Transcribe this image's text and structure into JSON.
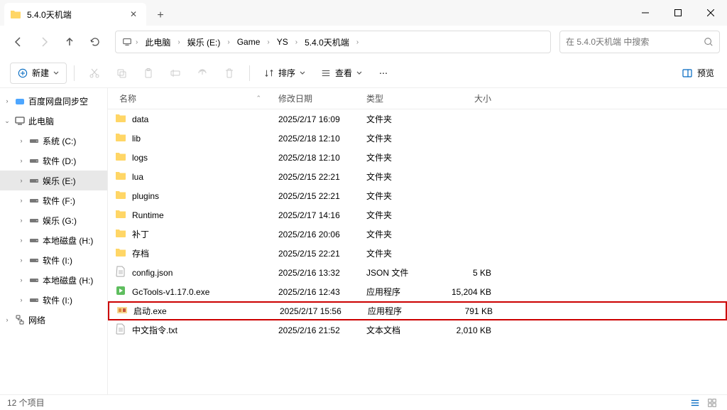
{
  "window": {
    "tab_title": "5.4.0天机端"
  },
  "breadcrumb": {
    "items": [
      "此电脑",
      "娱乐 (E:)",
      "Game",
      "YS",
      "5.4.0天机端"
    ]
  },
  "search": {
    "placeholder": "在 5.4.0天机端 中搜索"
  },
  "toolbar": {
    "new_label": "新建",
    "sort_label": "排序",
    "view_label": "查看",
    "preview_label": "预览"
  },
  "tree": {
    "items": [
      {
        "label": "百度网盘同步空",
        "icon": "cloud",
        "indent": 0,
        "chev": "right",
        "selected": false
      },
      {
        "label": "此电脑",
        "icon": "pc",
        "indent": 0,
        "chev": "down",
        "selected": false
      },
      {
        "label": "系统 (C:)",
        "icon": "drive",
        "indent": 1,
        "chev": "right",
        "selected": false
      },
      {
        "label": "软件 (D:)",
        "icon": "drive",
        "indent": 1,
        "chev": "right",
        "selected": false
      },
      {
        "label": "娱乐 (E:)",
        "icon": "drive",
        "indent": 1,
        "chev": "right",
        "selected": true
      },
      {
        "label": "软件 (F:)",
        "icon": "drive",
        "indent": 1,
        "chev": "right",
        "selected": false
      },
      {
        "label": "娱乐 (G:)",
        "icon": "drive",
        "indent": 1,
        "chev": "right",
        "selected": false
      },
      {
        "label": "本地磁盘 (H:)",
        "icon": "drive",
        "indent": 1,
        "chev": "right",
        "selected": false
      },
      {
        "label": "软件 (I:)",
        "icon": "drive",
        "indent": 1,
        "chev": "right",
        "selected": false
      },
      {
        "label": "本地磁盘 (H:)",
        "icon": "drive",
        "indent": 1,
        "chev": "right",
        "selected": false
      },
      {
        "label": "软件 (I:)",
        "icon": "drive",
        "indent": 1,
        "chev": "right",
        "selected": false
      },
      {
        "label": "网络",
        "icon": "network",
        "indent": 0,
        "chev": "right",
        "selected": false
      }
    ]
  },
  "columns": {
    "name": "名称",
    "date": "修改日期",
    "type": "类型",
    "size": "大小"
  },
  "files": [
    {
      "name": "data",
      "date": "2025/2/17 16:09",
      "type": "文件夹",
      "size": "",
      "icon": "folder",
      "highlighted": false
    },
    {
      "name": "lib",
      "date": "2025/2/18 12:10",
      "type": "文件夹",
      "size": "",
      "icon": "folder",
      "highlighted": false
    },
    {
      "name": "logs",
      "date": "2025/2/18 12:10",
      "type": "文件夹",
      "size": "",
      "icon": "folder",
      "highlighted": false
    },
    {
      "name": "lua",
      "date": "2025/2/15 22:21",
      "type": "文件夹",
      "size": "",
      "icon": "folder",
      "highlighted": false
    },
    {
      "name": "plugins",
      "date": "2025/2/15 22:21",
      "type": "文件夹",
      "size": "",
      "icon": "folder",
      "highlighted": false
    },
    {
      "name": "Runtime",
      "date": "2025/2/17 14:16",
      "type": "文件夹",
      "size": "",
      "icon": "folder",
      "highlighted": false
    },
    {
      "name": "补丁",
      "date": "2025/2/16 20:06",
      "type": "文件夹",
      "size": "",
      "icon": "folder",
      "highlighted": false
    },
    {
      "name": "存档",
      "date": "2025/2/15 22:21",
      "type": "文件夹",
      "size": "",
      "icon": "folder",
      "highlighted": false
    },
    {
      "name": "config.json",
      "date": "2025/2/16 13:32",
      "type": "JSON 文件",
      "size": "5 KB",
      "icon": "txt",
      "highlighted": false
    },
    {
      "name": "GcTools-v1.17.0.exe",
      "date": "2025/2/16 12:43",
      "type": "应用程序",
      "size": "15,204 KB",
      "icon": "exe-green",
      "highlighted": false
    },
    {
      "name": "启动.exe",
      "date": "2025/2/17 15:56",
      "type": "应用程序",
      "size": "791 KB",
      "icon": "exe-app",
      "highlighted": true
    },
    {
      "name": "中文指令.txt",
      "date": "2025/2/16 21:52",
      "type": "文本文档",
      "size": "2,010 KB",
      "icon": "txt",
      "highlighted": false
    }
  ],
  "status": {
    "count_label": "12 个项目"
  }
}
